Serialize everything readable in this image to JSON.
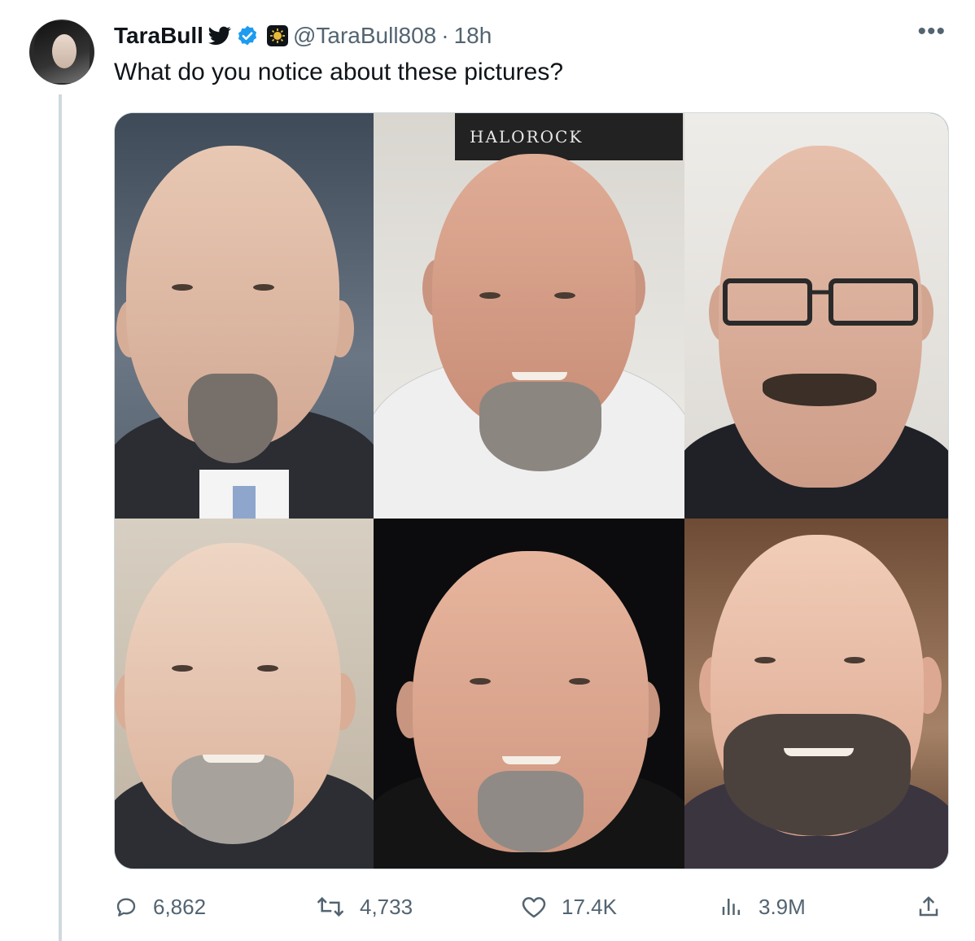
{
  "author": {
    "display_name": "TaraBull",
    "handle": "@TaraBull808",
    "separator": "·",
    "time": "18h",
    "icons": [
      "bird-icon",
      "verified-badge-icon",
      "affiliate-badge-icon"
    ]
  },
  "tweet": {
    "text": "What do you notice about these pictures?",
    "media_sign_text": "HALOROCK"
  },
  "actions": {
    "replies": "6,862",
    "reposts": "4,733",
    "likes": "17.4K",
    "views": "3.9M"
  },
  "colors": {
    "text_primary": "#0f1419",
    "text_secondary": "#536471",
    "verified_blue": "#1d9bf0",
    "divider": "#cfd9de"
  }
}
